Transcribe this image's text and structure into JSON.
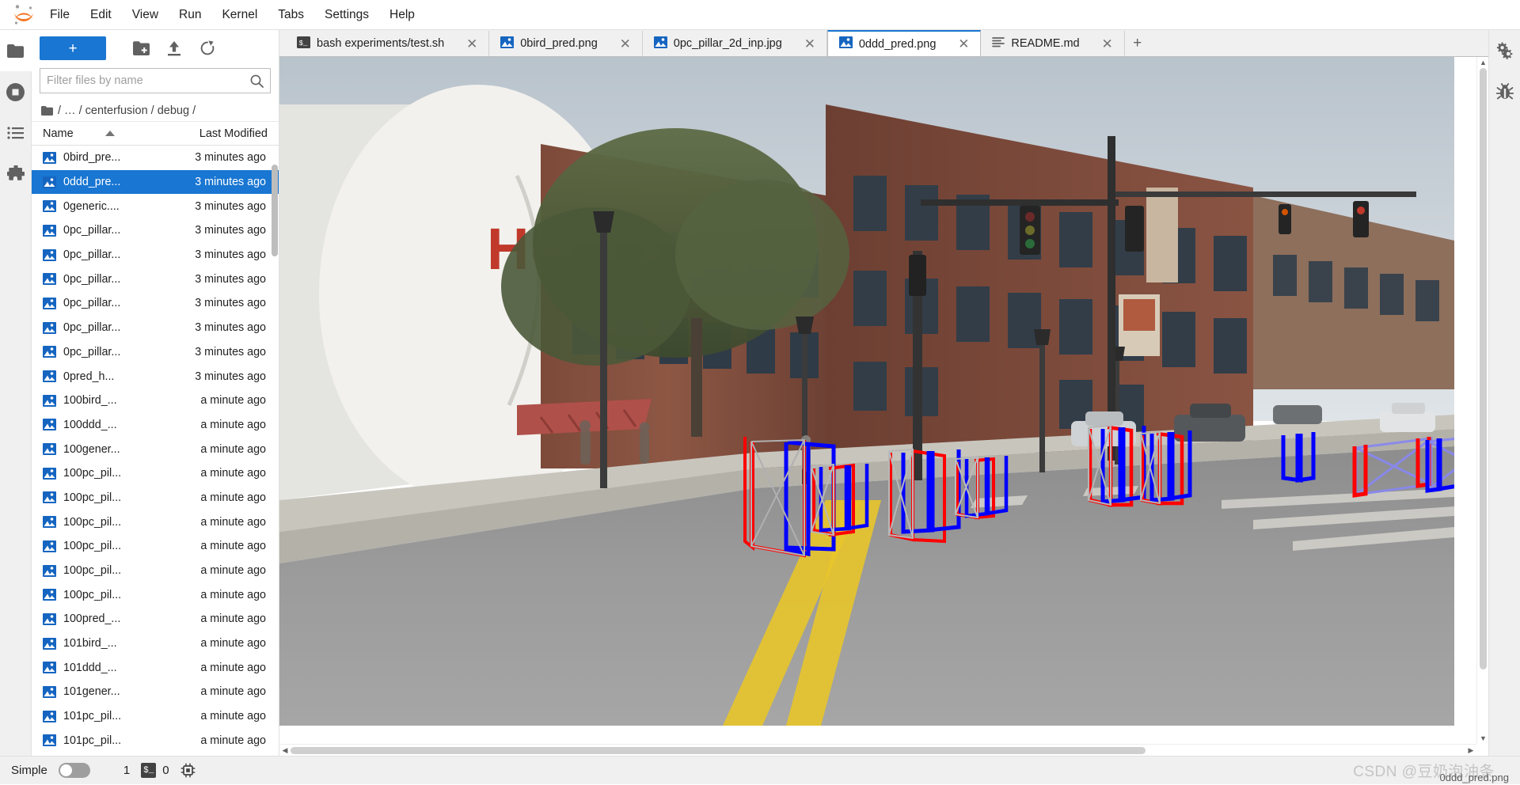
{
  "app": {
    "title": "JupyterLab",
    "logo_icon": "jupyter-logo"
  },
  "menubar": {
    "items": [
      {
        "label": "File"
      },
      {
        "label": "Edit"
      },
      {
        "label": "View"
      },
      {
        "label": "Run"
      },
      {
        "label": "Kernel"
      },
      {
        "label": "Tabs"
      },
      {
        "label": "Settings"
      },
      {
        "label": "Help"
      }
    ]
  },
  "left_sidebar": {
    "items": [
      {
        "name": "file-browser",
        "icon": "folder-icon",
        "active": true
      },
      {
        "name": "running-terminals-kernels",
        "icon": "stop-circle-icon",
        "active": false
      },
      {
        "name": "commands",
        "icon": "list-icon",
        "active": false
      },
      {
        "name": "extension-manager",
        "icon": "puzzle-icon",
        "active": false
      }
    ]
  },
  "right_sidebar": {
    "items": [
      {
        "name": "property-inspector",
        "icon": "gears-icon"
      },
      {
        "name": "debugger",
        "icon": "bug-icon"
      }
    ]
  },
  "filebrowser": {
    "toolbar": {
      "new_launcher_label": "+",
      "new_folder_icon": "new-folder-icon",
      "upload_icon": "upload-icon",
      "refresh_icon": "refresh-icon"
    },
    "filter": {
      "placeholder": "Filter files by name",
      "value": "",
      "search_icon": "search-icon"
    },
    "breadcrumb": {
      "root_icon": "folder-icon",
      "parts": [
        "/",
        "…",
        "/",
        "centerfusion",
        "/",
        "debug",
        "/"
      ],
      "text": "/ … / centerfusion / debug /"
    },
    "columns": {
      "name": "Name",
      "last_modified": "Last Modified",
      "sort_icon": "sort-ascending-icon"
    },
    "files": [
      {
        "name": "0bird_pre...",
        "modified": "3 minutes ago",
        "icon": "image-file-icon",
        "selected": false
      },
      {
        "name": "0ddd_pre...",
        "modified": "3 minutes ago",
        "icon": "image-file-icon",
        "selected": true
      },
      {
        "name": "0generic....",
        "modified": "3 minutes ago",
        "icon": "image-file-icon",
        "selected": false
      },
      {
        "name": "0pc_pillar...",
        "modified": "3 minutes ago",
        "icon": "image-file-icon",
        "selected": false
      },
      {
        "name": "0pc_pillar...",
        "modified": "3 minutes ago",
        "icon": "image-file-icon",
        "selected": false
      },
      {
        "name": "0pc_pillar...",
        "modified": "3 minutes ago",
        "icon": "image-file-icon",
        "selected": false
      },
      {
        "name": "0pc_pillar...",
        "modified": "3 minutes ago",
        "icon": "image-file-icon",
        "selected": false
      },
      {
        "name": "0pc_pillar...",
        "modified": "3 minutes ago",
        "icon": "image-file-icon",
        "selected": false
      },
      {
        "name": "0pc_pillar...",
        "modified": "3 minutes ago",
        "icon": "image-file-icon",
        "selected": false
      },
      {
        "name": "0pred_h...",
        "modified": "3 minutes ago",
        "icon": "image-file-icon",
        "selected": false
      },
      {
        "name": "100bird_...",
        "modified": "a minute ago",
        "icon": "image-file-icon",
        "selected": false
      },
      {
        "name": "100ddd_...",
        "modified": "a minute ago",
        "icon": "image-file-icon",
        "selected": false
      },
      {
        "name": "100gener...",
        "modified": "a minute ago",
        "icon": "image-file-icon",
        "selected": false
      },
      {
        "name": "100pc_pil...",
        "modified": "a minute ago",
        "icon": "image-file-icon",
        "selected": false
      },
      {
        "name": "100pc_pil...",
        "modified": "a minute ago",
        "icon": "image-file-icon",
        "selected": false
      },
      {
        "name": "100pc_pil...",
        "modified": "a minute ago",
        "icon": "image-file-icon",
        "selected": false
      },
      {
        "name": "100pc_pil...",
        "modified": "a minute ago",
        "icon": "image-file-icon",
        "selected": false
      },
      {
        "name": "100pc_pil...",
        "modified": "a minute ago",
        "icon": "image-file-icon",
        "selected": false
      },
      {
        "name": "100pc_pil...",
        "modified": "a minute ago",
        "icon": "image-file-icon",
        "selected": false
      },
      {
        "name": "100pred_...",
        "modified": "a minute ago",
        "icon": "image-file-icon",
        "selected": false
      },
      {
        "name": "101bird_...",
        "modified": "a minute ago",
        "icon": "image-file-icon",
        "selected": false
      },
      {
        "name": "101ddd_...",
        "modified": "a minute ago",
        "icon": "image-file-icon",
        "selected": false
      },
      {
        "name": "101gener...",
        "modified": "a minute ago",
        "icon": "image-file-icon",
        "selected": false
      },
      {
        "name": "101pc_pil...",
        "modified": "a minute ago",
        "icon": "image-file-icon",
        "selected": false
      },
      {
        "name": "101pc_pil...",
        "modified": "a minute ago",
        "icon": "image-file-icon",
        "selected": false
      }
    ]
  },
  "tabs": {
    "items": [
      {
        "label": "bash experiments/test.sh",
        "icon": "terminal-icon",
        "active": false,
        "close_icon": "close-icon"
      },
      {
        "label": "0bird_pred.png",
        "icon": "image-file-icon",
        "active": false,
        "close_icon": "close-icon"
      },
      {
        "label": "0pc_pillar_2d_inp.jpg",
        "icon": "image-file-icon",
        "active": false,
        "close_icon": "close-icon"
      },
      {
        "label": "0ddd_pred.png",
        "icon": "image-file-icon",
        "active": true,
        "close_icon": "close-icon"
      },
      {
        "label": "README.md",
        "icon": "markdown-icon",
        "active": false,
        "close_icon": "close-icon"
      }
    ],
    "add_tab_label": "+"
  },
  "viewer": {
    "filename_label": "0ddd_pred.png",
    "content_description": "Street scene with 3D bounding box predictions (red) and ground truth (blue) overlaid on pedestrians and vehicles",
    "box_colors": {
      "prediction": "#ff0000",
      "ground_truth": "#0000ff"
    },
    "scroll_vertical_icon": "scrollbar-vertical",
    "scroll_horizontal_icon": "scrollbar-horizontal"
  },
  "statusbar": {
    "mode_label": "Simple",
    "mode_enabled": false,
    "kernel_count": "1",
    "terminal_icon": "terminal-icon",
    "terminal_count": "0",
    "kernel_icon": "cpu-chip-icon",
    "watermark": "CSDN @豆奶泡油条"
  }
}
